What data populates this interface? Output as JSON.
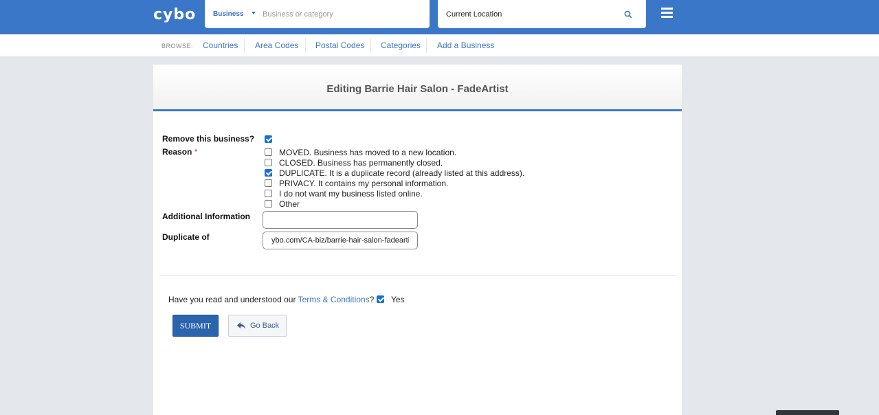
{
  "header": {
    "logo": "cybo",
    "category_select": "Business",
    "search_placeholder": "Business or category",
    "location_value": "Current Location"
  },
  "browse": {
    "label": "BROWSE:",
    "links": [
      "Countries",
      "Area Codes",
      "Postal Codes",
      "Categories",
      "Add a Business"
    ]
  },
  "form": {
    "title": "Editing Barrie Hair Salon - FadeArtist",
    "remove_label": "Remove this business?",
    "remove_checked": true,
    "reason_label": "Reason",
    "required_mark": "*",
    "reasons": [
      {
        "text": "MOVED. Business has moved to a new location.",
        "checked": false
      },
      {
        "text": "CLOSED. Business has permanently closed.",
        "checked": false
      },
      {
        "text": "DUPLICATE. It is a duplicate record (already listed at this address).",
        "checked": true
      },
      {
        "text": "PRIVACY. It contains my personal information.",
        "checked": false
      },
      {
        "text": "I do not want my business listed online.",
        "checked": false
      },
      {
        "text": "Other",
        "checked": false
      }
    ],
    "additional_label": "Additional Information",
    "additional_value": "",
    "duplicate_label": "Duplicate of",
    "duplicate_value": "ybo.com/CA-biz/barrie-hair-salon-fadeartist",
    "terms_question": "Have you read and understood our ",
    "terms_link": "Terms & Conditions",
    "terms_suffix": "?",
    "terms_checked": true,
    "terms_yes": "Yes",
    "submit_label": "SUBMIT",
    "back_label": "Go Back"
  },
  "colors": {
    "brand_blue": "#3b77c8",
    "link_blue": "#3c77c5",
    "submit_blue": "#2a64ad"
  }
}
